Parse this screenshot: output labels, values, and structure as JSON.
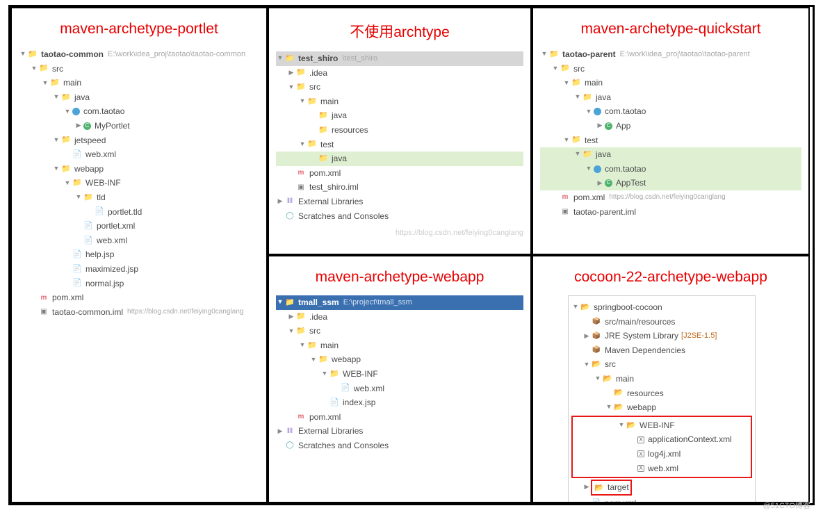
{
  "footer": "@51CTO博客",
  "cells": {
    "c1": {
      "title": "不使用archtype",
      "root_name": "test_shiro",
      "root_path": "\\test_shiro",
      "idea": ".idea",
      "src": "src",
      "main": "main",
      "java": "java",
      "resources": "resources",
      "test": "test",
      "java2": "java",
      "pom": "pom.xml",
      "iml": "test_shiro.iml",
      "ext": "External Libraries",
      "scr": "Scratches and Consoles",
      "wm": "https://blog.csdn.net/feiying0canglang"
    },
    "c2": {
      "title": "maven-archetype-quickstart",
      "root_name": "taotao-parent",
      "root_path": "E:\\work\\idea_proj\\taotao\\taotao-parent",
      "src": "src",
      "main": "main",
      "java": "java",
      "pkg": "com.taotao",
      "app": "App",
      "test": "test",
      "java2": "java",
      "pkg2": "com.taotao",
      "apptest": "AppTest",
      "pom": "pom.xml",
      "iml": "taotao-parent.iml",
      "wm": "https://blog.csdn.net/feiying0canglang"
    },
    "c3": {
      "title": "maven-archetype-portlet",
      "root_name": "taotao-common",
      "root_path": "E:\\work\\idea_proj\\taotao\\taotao-common",
      "src": "src",
      "main": "main",
      "java": "java",
      "pkg": "com.taotao",
      "port": "MyPortlet",
      "jet": "jetspeed",
      "web1": "web.xml",
      "webapp": "webapp",
      "webinf": "WEB-INF",
      "tld": "tld",
      "ptld": "portlet.tld",
      "pxml": "portlet.xml",
      "web2": "web.xml",
      "help": "help.jsp",
      "max": "maximized.jsp",
      "norm": "normal.jsp",
      "pom": "pom.xml",
      "iml": "taotao-common.iml",
      "wm": "https://blog.csdn.net/feiying0canglang"
    },
    "c4": {
      "title": "maven-archetype-webapp",
      "root_name": "tmall_ssm",
      "root_path": "E:\\project\\tmall_ssm",
      "idea": ".idea",
      "src": "src",
      "main": "main",
      "webapp": "webapp",
      "webinf": "WEB-INF",
      "web": "web.xml",
      "idx": "index.jsp",
      "pom": "pom.xml",
      "ext": "External Libraries",
      "scr": "Scratches and Consoles"
    },
    "c5": {
      "title": "cocoon-22-archetype-webapp",
      "root": "springboot-cocoon",
      "res": "src/main/resources",
      "jre": "JRE System Library",
      "jretag": "[J2SE-1.5]",
      "mvn": "Maven Dependencies",
      "src": "src",
      "main": "main",
      "resources": "resources",
      "webapp": "webapp",
      "webinf": "WEB-INF",
      "app": "applicationContext.xml",
      "log": "log4j.xml",
      "web": "web.xml",
      "target": "target",
      "pom": "pom.xml"
    }
  }
}
